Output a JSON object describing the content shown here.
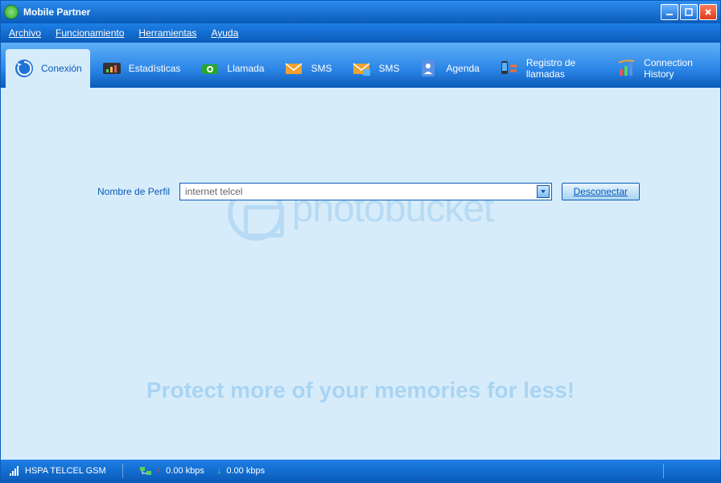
{
  "title": "Mobile Partner",
  "menu": {
    "archivo": "Archivo",
    "funcionamiento": "Funcionamiento",
    "herramientas": "Herramientas",
    "ayuda": "Ayuda"
  },
  "toolbar": {
    "conexion": "Conexión",
    "estadisticas": "Estadísticas",
    "llamada": "Llamada",
    "sms1": "SMS",
    "sms2": "SMS",
    "agenda": "Agenda",
    "registro": "Registro de llamadas",
    "history": "Connection History"
  },
  "form": {
    "label": "Nombre de Perfil",
    "value": "internet telcel",
    "disconnect": "Desconectar"
  },
  "watermark": {
    "brand": "photobucket",
    "tagline": "Protect more of your memories for less!"
  },
  "status": {
    "network": "HSPA  TELCEL  GSM",
    "up_rate": "0.00 kbps",
    "down_rate": "0.00 kbps"
  }
}
